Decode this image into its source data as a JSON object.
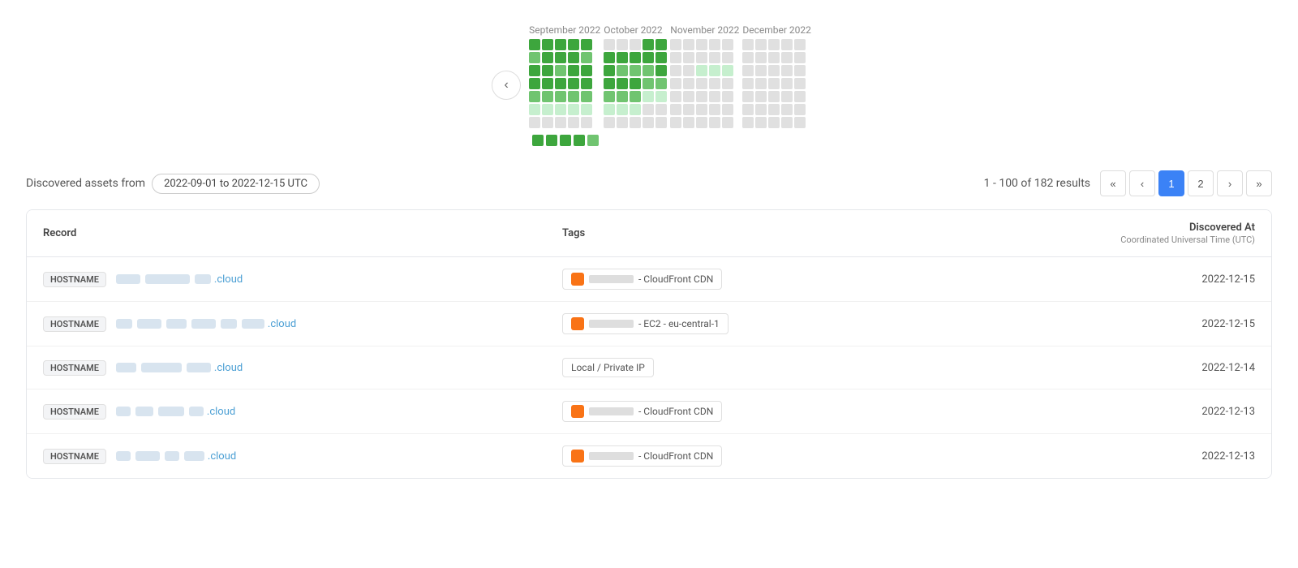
{
  "calendar": {
    "prev_label": "‹",
    "months": [
      {
        "label": "September 2022",
        "cells": [
          "dark",
          "dark",
          "dark",
          "dark",
          "dark",
          "medium",
          "dark",
          "dark",
          "dark",
          "medium",
          "dark",
          "dark",
          "medium",
          "dark",
          "dark",
          "dark",
          "dark",
          "dark",
          "dark",
          "dark",
          "medium",
          "medium",
          "medium",
          "medium",
          "medium",
          "light",
          "light",
          "light",
          "light",
          "light",
          "gray",
          "gray",
          "gray",
          "gray",
          "gray"
        ]
      },
      {
        "label": "October 2022",
        "cells": [
          "gray",
          "gray",
          "gray",
          "dark",
          "dark",
          "dark",
          "dark",
          "dark",
          "dark",
          "dark",
          "dark",
          "medium",
          "medium",
          "medium",
          "dark",
          "dark",
          "dark",
          "dark",
          "medium",
          "medium",
          "medium",
          "medium",
          "medium",
          "light",
          "light",
          "light",
          "light",
          "light",
          "gray",
          "gray",
          "gray",
          "gray",
          "gray",
          "gray",
          "gray"
        ]
      },
      {
        "label": "November 2022",
        "cells": [
          "gray",
          "gray",
          "gray",
          "gray",
          "gray",
          "gray",
          "gray",
          "gray",
          "gray",
          "gray",
          "gray",
          "gray",
          "light",
          "light",
          "light",
          "gray",
          "gray",
          "gray",
          "gray",
          "gray",
          "gray",
          "gray",
          "gray",
          "gray",
          "gray",
          "gray",
          "gray",
          "gray",
          "gray",
          "gray",
          "gray",
          "gray",
          "gray",
          "gray",
          "gray"
        ]
      },
      {
        "label": "December 2022",
        "cells": [
          "gray",
          "gray",
          "gray",
          "gray",
          "gray",
          "gray",
          "gray",
          "gray",
          "gray",
          "gray",
          "gray",
          "gray",
          "gray",
          "gray",
          "gray",
          "gray",
          "gray",
          "gray",
          "gray",
          "gray",
          "gray",
          "gray",
          "gray",
          "gray",
          "gray",
          "gray",
          "gray",
          "gray",
          "gray",
          "gray",
          "gray",
          "gray",
          "gray",
          "gray",
          "gray"
        ]
      }
    ],
    "legend": [
      "dark",
      "dark",
      "dark",
      "dark",
      "medium"
    ]
  },
  "filter": {
    "label": "Discovered assets from",
    "date_range": "2022-09-01 to 2022-12-15  UTC"
  },
  "pagination": {
    "results_text": "1 - 100 of 182 results",
    "first_btn": "«",
    "prev_btn": "‹",
    "page1": "1",
    "page2": "2",
    "next_btn": "›",
    "last_btn": "»"
  },
  "table": {
    "col_record": "Record",
    "col_tags": "Tags",
    "col_discovered_title": "Discovered At",
    "col_discovered_subtitle": "Coordinated Universal Time (UTC)",
    "rows": [
      {
        "type": "HOSTNAME",
        "name_segments": [
          30,
          55,
          20
        ],
        "suffix": ".cloud",
        "tag_color": "orange",
        "tag_text_width": 55,
        "tag_label": "- CloudFront CDN",
        "date": "2022-12-15"
      },
      {
        "type": "HOSTNAME",
        "name_segments": [
          20,
          30,
          25,
          30,
          20,
          28
        ],
        "suffix": ".cloud",
        "tag_color": "orange",
        "tag_text_width": 55,
        "tag_label": "- EC2 - eu-central-1",
        "date": "2022-12-15"
      },
      {
        "type": "HOSTNAME",
        "name_segments": [
          25,
          50,
          30
        ],
        "suffix": ".cloud",
        "tag_color": "local",
        "tag_label": "Local / Private IP",
        "date": "2022-12-14"
      },
      {
        "type": "HOSTNAME",
        "name_segments": [
          18,
          22,
          32,
          18
        ],
        "suffix": ".cloud",
        "tag_color": "orange",
        "tag_text_width": 55,
        "tag_label": "- CloudFront CDN",
        "date": "2022-12-13"
      },
      {
        "type": "HOSTNAME",
        "name_segments": [
          18,
          30,
          18,
          25
        ],
        "suffix": ".cloud",
        "tag_color": "orange",
        "tag_text_width": 55,
        "tag_label": "- CloudFront CDN",
        "date": "2022-12-13"
      }
    ]
  }
}
